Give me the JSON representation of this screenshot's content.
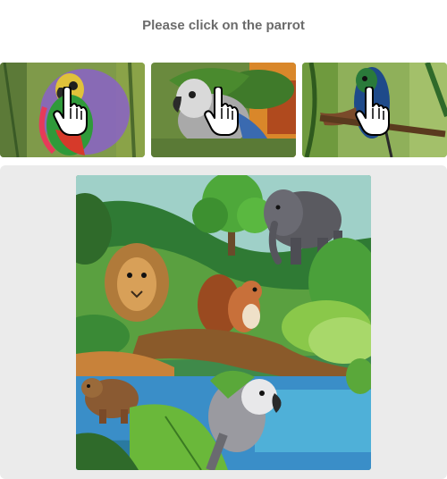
{
  "instruction": "Please click on the parrot",
  "thumbnails": [
    {
      "subject": "parrot",
      "icon": "hand-pointer-icon"
    },
    {
      "subject": "parrot",
      "icon": "hand-pointer-icon"
    },
    {
      "subject": "parrot",
      "icon": "hand-pointer-icon"
    }
  ],
  "scene": {
    "animals": [
      "elephant",
      "lion",
      "squirrel",
      "bear",
      "parrot"
    ]
  }
}
